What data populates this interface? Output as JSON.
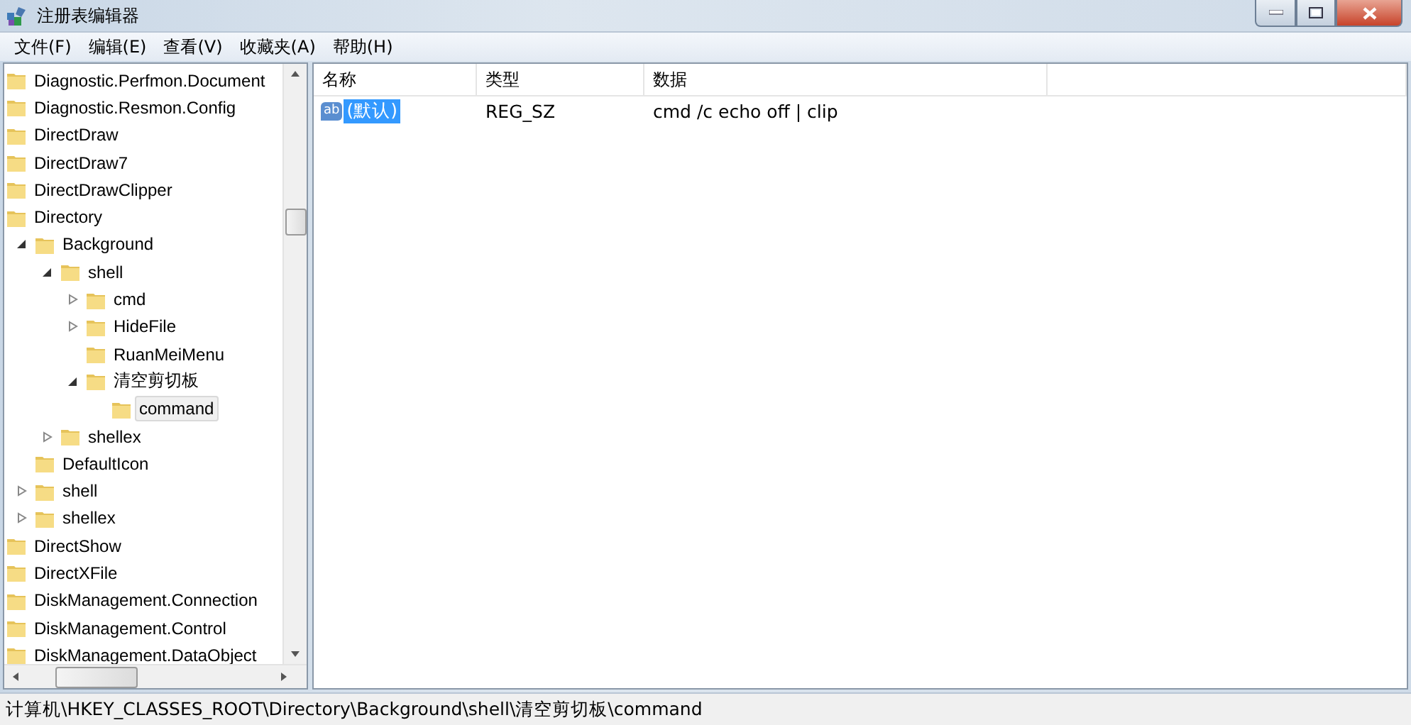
{
  "window": {
    "title": "注册表编辑器"
  },
  "menu": [
    "文件(F)",
    "编辑(E)",
    "查看(V)",
    "收藏夹(A)",
    "帮助(H)"
  ],
  "tree": [
    {
      "label": "Diagnostic.Perfmon.Document",
      "selected": false
    },
    {
      "label": "Diagnostic.Resmon.Config",
      "selected": false
    },
    {
      "label": "DirectDraw",
      "selected": false
    },
    {
      "label": "DirectDraw7",
      "selected": false
    },
    {
      "label": "DirectDrawClipper",
      "selected": false
    },
    {
      "label": "Directory",
      "selected": false,
      "children": [
        {
          "label": "Background",
          "selected": false,
          "expanded": true,
          "children": [
            {
              "label": "shell",
              "selected": false,
              "expanded": true,
              "children": [
                {
                  "label": "cmd",
                  "selected": false,
                  "expanded": false
                },
                {
                  "label": "HideFile",
                  "selected": false,
                  "expanded": false
                },
                {
                  "label": "RuanMeiMenu",
                  "selected": false
                },
                {
                  "label": "清空剪切板",
                  "selected": false,
                  "expanded": true,
                  "children": [
                    {
                      "label": "command",
                      "selected": true
                    }
                  ]
                }
              ]
            },
            {
              "label": "shellex",
              "selected": false,
              "expanded": false
            }
          ]
        },
        {
          "label": "DefaultIcon",
          "selected": false
        },
        {
          "label": "shell",
          "selected": false,
          "expanded": false
        },
        {
          "label": "shellex",
          "selected": false,
          "expanded": false
        }
      ]
    },
    {
      "label": "DirectShow",
      "selected": false
    },
    {
      "label": "DirectXFile",
      "selected": false
    },
    {
      "label": "DiskManagement.Connection",
      "selected": false
    },
    {
      "label": "DiskManagement.Control",
      "selected": false
    },
    {
      "label": "DiskManagement.DataObject",
      "selected": false
    }
  ],
  "table": {
    "columns": [
      "名称",
      "类型",
      "数据"
    ],
    "rows": [
      {
        "icon_text": "ab",
        "name": "(默认)",
        "type": "REG_SZ",
        "data": "cmd /c echo off | clip",
        "selected": true
      }
    ]
  },
  "status_bar": "计算机\\HKEY_CLASSES_ROOT\\Directory\\Background\\shell\\清空剪切板\\command"
}
